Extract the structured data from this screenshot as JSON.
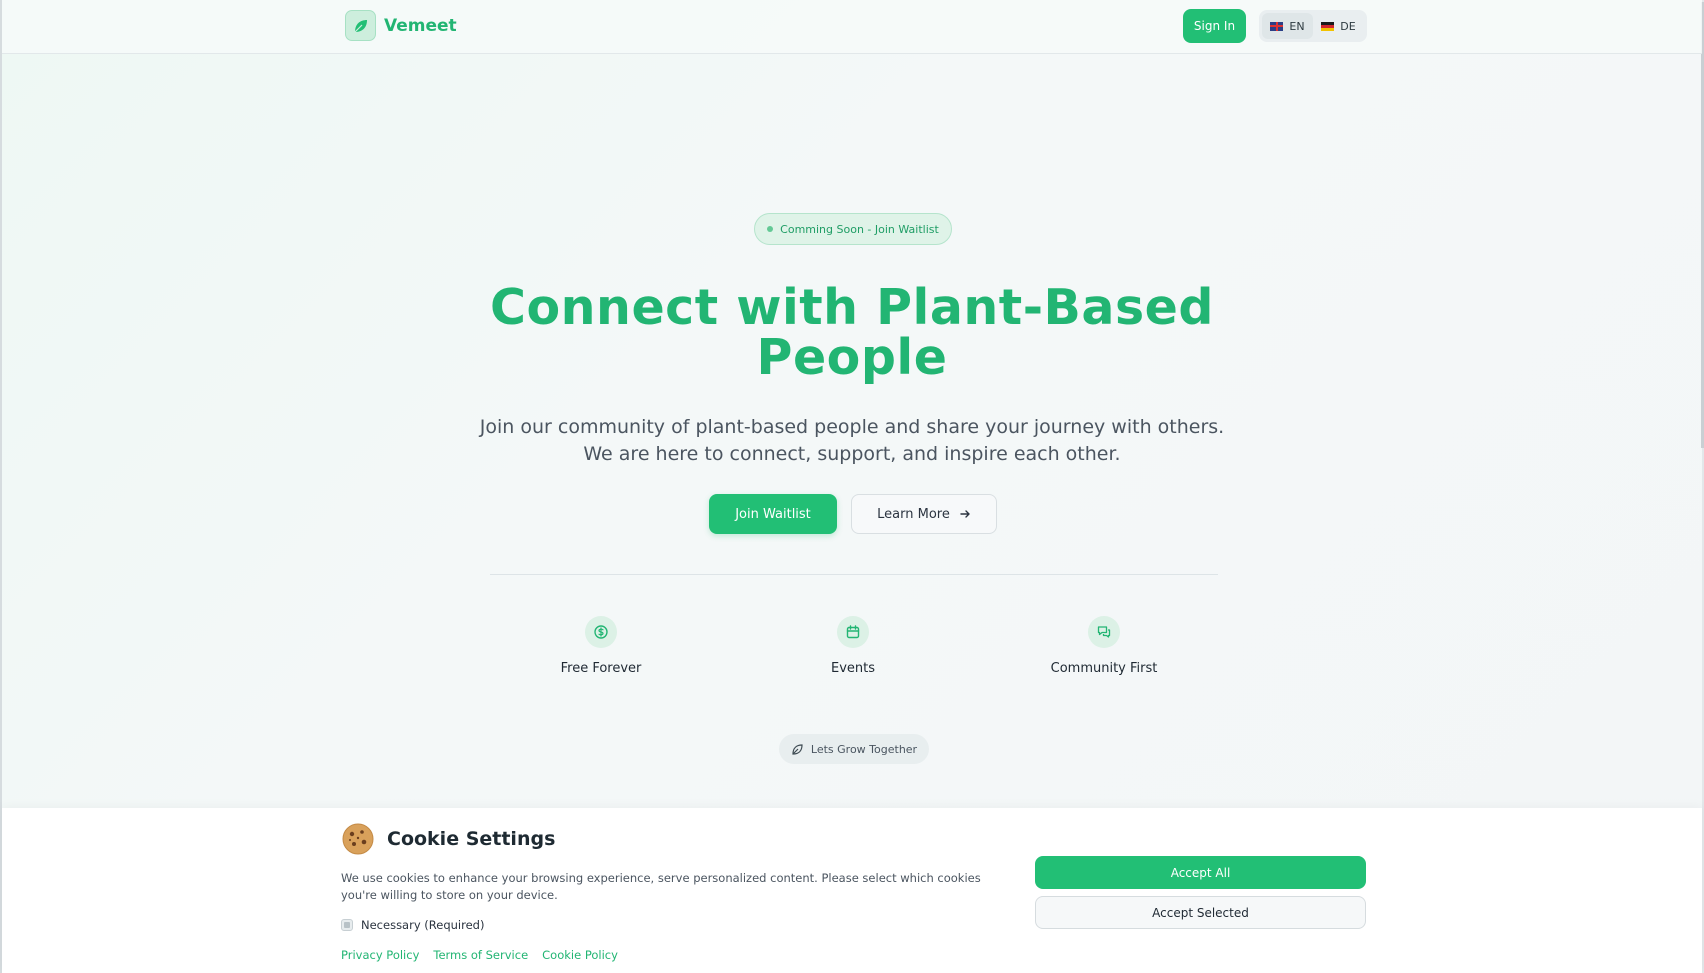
{
  "header": {
    "brand_name": "Vemeet",
    "signin_label": "Sign In",
    "languages": [
      {
        "code": "EN",
        "active": true
      },
      {
        "code": "DE",
        "active": false
      }
    ]
  },
  "hero": {
    "badge_text": "Comming Soon - Join Waitlist",
    "title_line1": "Connect with Plant-Based",
    "title_line2": "People",
    "subtitle_line1": "Join our community of plant-based people and share your journey with others.",
    "subtitle_line2": "We are here to connect, support, and inspire each other.",
    "primary_cta": "Join Waitlist",
    "secondary_cta": "Learn More"
  },
  "features": [
    {
      "label": "Free Forever",
      "icon": "dollar-icon"
    },
    {
      "label": "Events",
      "icon": "calendar-icon"
    },
    {
      "label": "Community First",
      "icon": "chat-icon"
    }
  ],
  "tagline": "Lets Grow Together",
  "cookie": {
    "title": "Cookie Settings",
    "text": "We use cookies to enhance your browsing experience, serve personalized content. Please select which cookies you're willing to store on your device.",
    "necessary_label": "Necessary (Required)",
    "links": [
      "Privacy Policy",
      "Terms of Service",
      "Cookie Policy"
    ],
    "accept_all": "Accept All",
    "accept_selected": "Accept Selected"
  },
  "colors": {
    "accent": "#22bf75",
    "accent_text": "#22b573",
    "background": "#f3f7f6"
  }
}
